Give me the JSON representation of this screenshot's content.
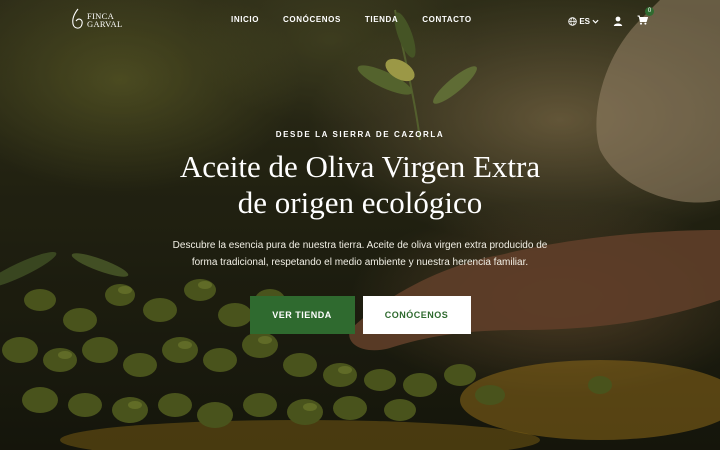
{
  "brand": {
    "line1": "FINCA",
    "line2": "GARVAL"
  },
  "nav": {
    "items": [
      "INICIO",
      "CONÓCENOS",
      "TIENDA",
      "CONTACTO"
    ]
  },
  "header_tools": {
    "language": "ES",
    "cart_count": "0"
  },
  "hero": {
    "eyebrow": "DESDE LA SIERRA DE CAZORLA",
    "title_line1": "Aceite de Oliva Virgen Extra",
    "title_line2": "de origen ecológico",
    "description": "Descubre la esencia pura de nuestra tierra. Aceite de oliva virgen extra producido de forma tradicional, respetando el medio ambiente y nuestra herencia familiar.",
    "primary_cta": "VER TIENDA",
    "secondary_cta": "CONÓCENOS"
  },
  "colors": {
    "primary": "#2f6a2f",
    "text": "#ffffff",
    "secondary_bg": "#ffffff"
  },
  "icons": [
    "globe-icon",
    "chevron-down-icon",
    "user-icon",
    "cart-icon"
  ]
}
